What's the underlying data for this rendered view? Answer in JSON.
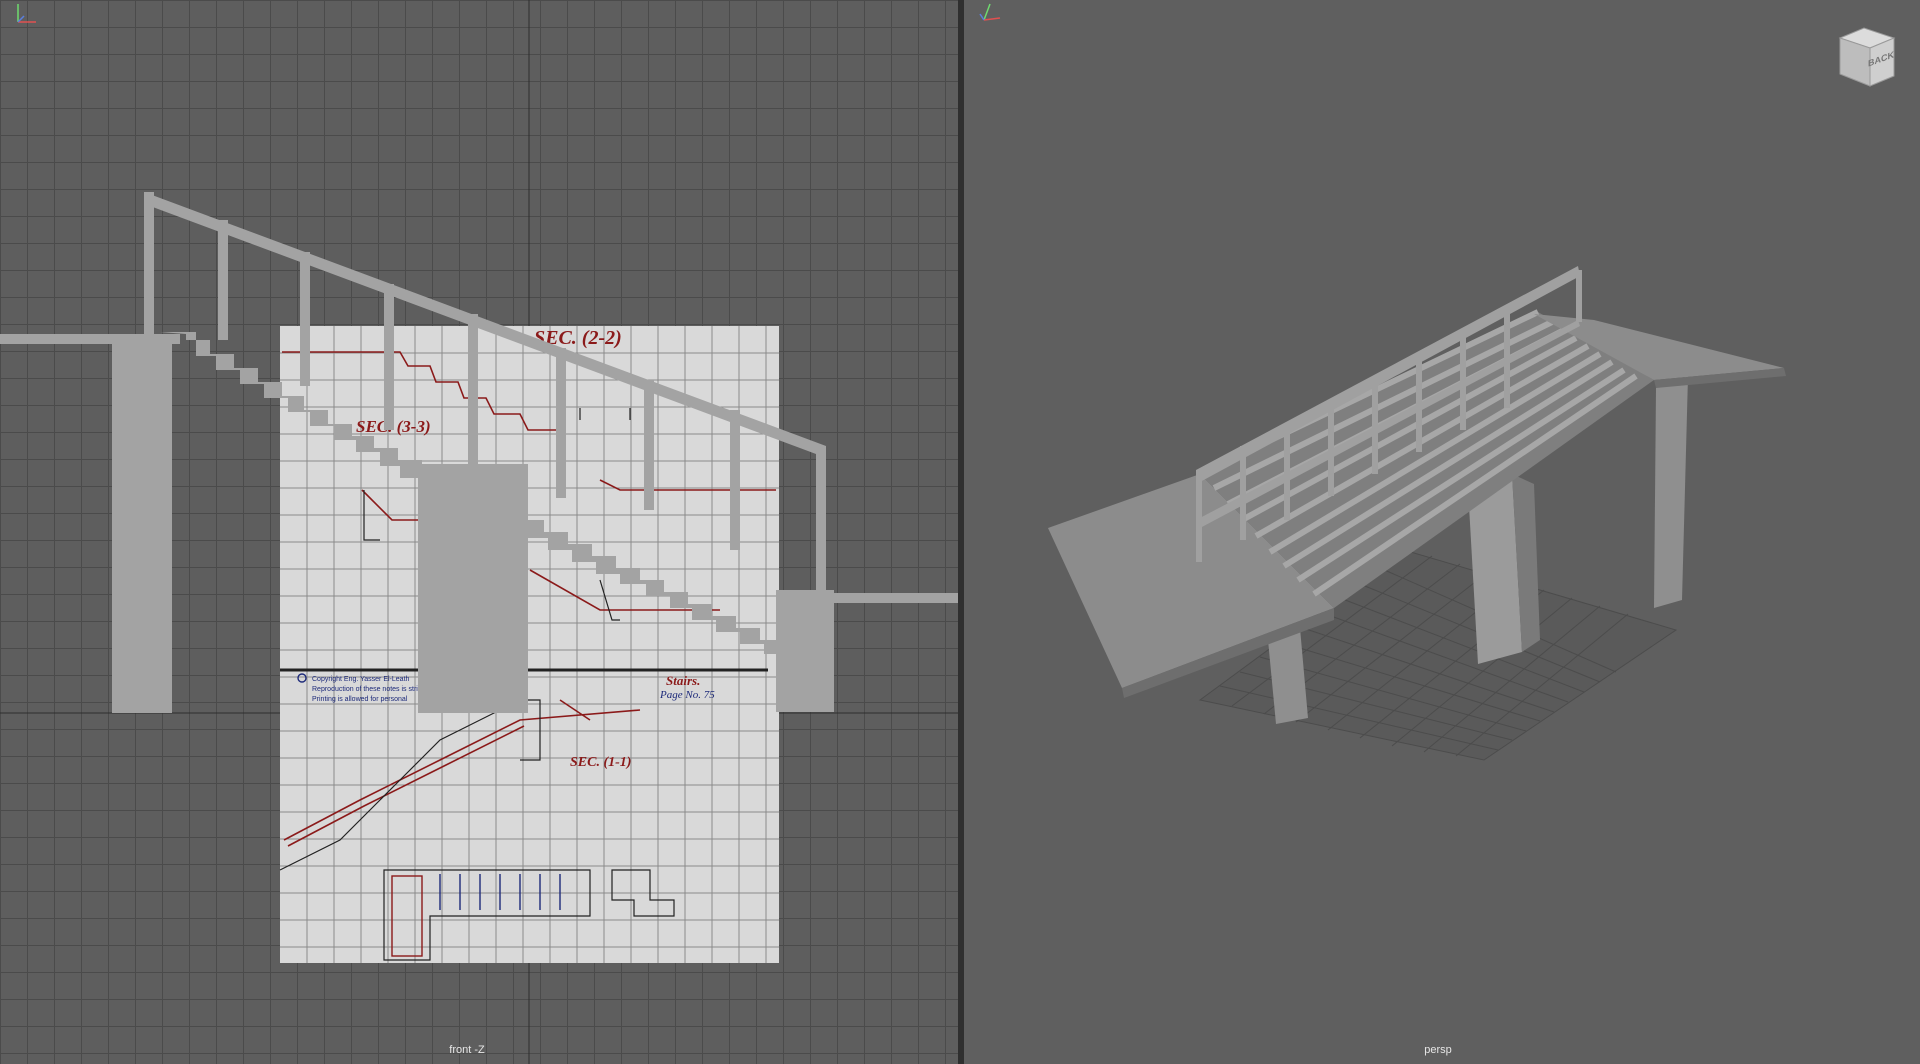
{
  "viewports": {
    "front": {
      "label": "front -Z",
      "reference_image": {
        "sec_2_2": "SEC. (2-2)",
        "sec_3_3": "SEC. (3-3)",
        "sec_1_1": "SEC. (1-1)",
        "stairs": "Stairs.",
        "page_no": "Page No.  75",
        "copyright": "Copyright Eng. Yasser El-Leath",
        "repro": "Reproduction of these notes is strictly prohibited.",
        "printing": "Printing is allowed for personal"
      }
    },
    "persp": {
      "label": "persp",
      "viewcube": {
        "face": "BACK"
      }
    }
  },
  "axis_labels": {
    "y": "Y",
    "x": "X"
  },
  "colors": {
    "grid_bg": "#5e5e5e",
    "grid_line": "#4b4b4b",
    "persp_bg": "#5f5f5f",
    "model_gray": "#a8a8a8",
    "drawing_red": "#8b1a1a",
    "drawing_blue": "#1d2a7a"
  }
}
